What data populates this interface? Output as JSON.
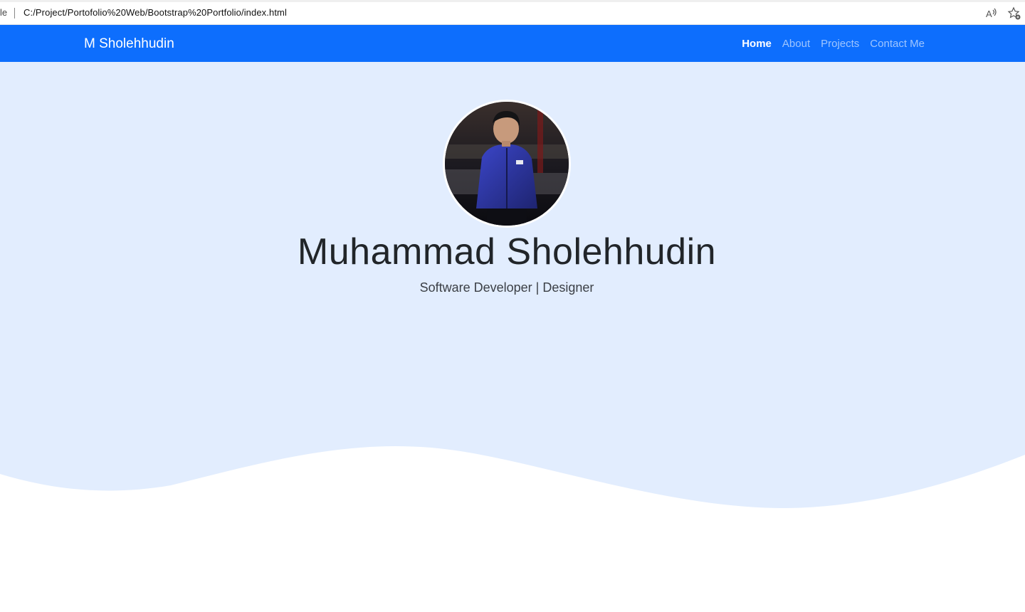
{
  "browser": {
    "url_prefix": "le",
    "url": "C:/Project/Portofolio%20Web/Bootstrap%20Portfolio/index.html",
    "read_aloud_icon": "read-aloud-icon",
    "favorite_icon": "add-favorite-icon"
  },
  "navbar": {
    "brand": "M Sholehhudin",
    "links": [
      {
        "label": "Home",
        "active": true
      },
      {
        "label": "About",
        "active": false
      },
      {
        "label": "Projects",
        "active": false
      },
      {
        "label": "Contact Me",
        "active": false
      }
    ],
    "background": "#0d6efd"
  },
  "hero": {
    "name": "Muhammad Sholehhudin",
    "subtitle": "Software Developer | Designer",
    "background": "#e2edfe"
  }
}
